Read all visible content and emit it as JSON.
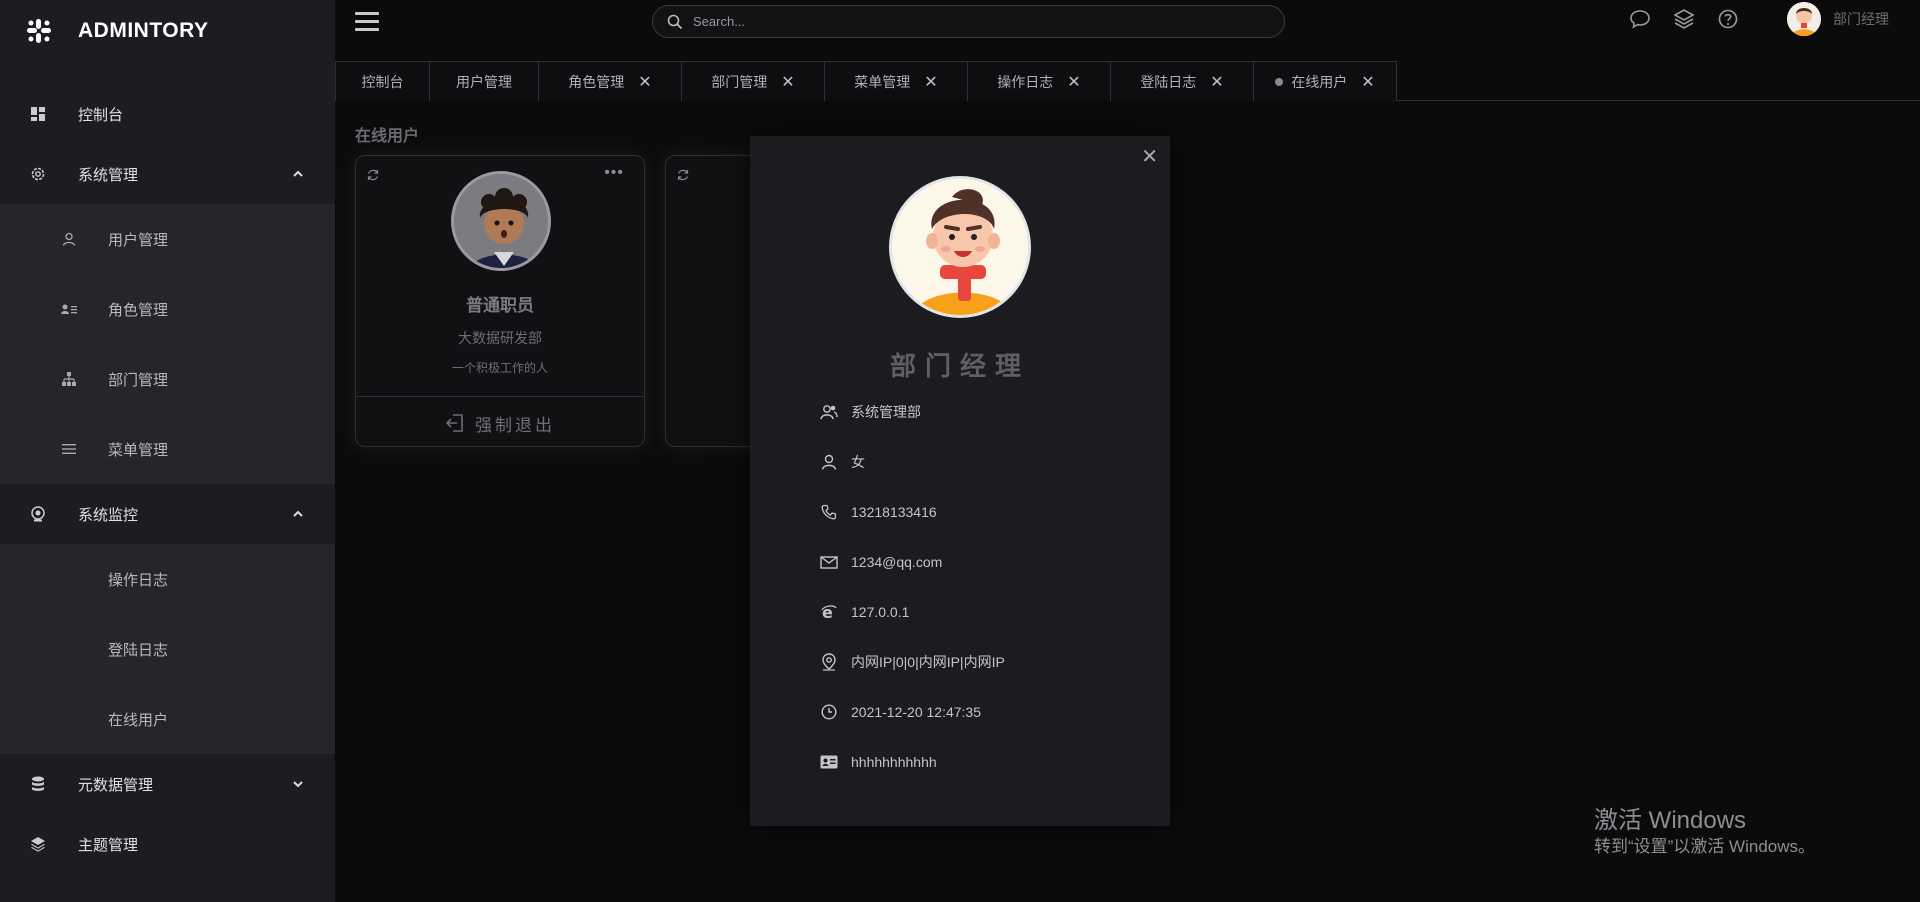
{
  "brand": {
    "name": "ADMINTORY"
  },
  "sidebar": {
    "items": [
      {
        "label": "控制台"
      },
      {
        "label": "系统管理"
      },
      {
        "label": "系统监控"
      },
      {
        "label": "元数据管理"
      },
      {
        "label": "主题管理"
      }
    ],
    "system_sub": [
      {
        "label": "用户管理"
      },
      {
        "label": "角色管理"
      },
      {
        "label": "部门管理"
      },
      {
        "label": "菜单管理"
      }
    ],
    "monitor_sub": [
      {
        "label": "操作日志"
      },
      {
        "label": "登陆日志"
      },
      {
        "label": "在线用户"
      }
    ]
  },
  "header": {
    "search_placeholder": "Search...",
    "user_name": "部门经理"
  },
  "tabs": [
    {
      "label": "控制台",
      "closable": false
    },
    {
      "label": "用户管理",
      "closable": false
    },
    {
      "label": "角色管理",
      "closable": true
    },
    {
      "label": "部门管理",
      "closable": true
    },
    {
      "label": "菜单管理",
      "closable": true
    },
    {
      "label": "操作日志",
      "closable": true
    },
    {
      "label": "登陆日志",
      "closable": true
    },
    {
      "label": "在线用户",
      "closable": true,
      "active": true
    }
  ],
  "tab_close_glyph": "✕",
  "page": {
    "title": "在线用户"
  },
  "card": {
    "name": "普通职员",
    "dept": "大数据研发部",
    "motto": "一个积极工作的人",
    "logout_label": "强制退出",
    "more_glyph": "•••"
  },
  "modal": {
    "close_glyph": "✕",
    "role": "部门经理",
    "dept": "系统管理部",
    "gender": "女",
    "phone": "13218133416",
    "email": "1234@qq.com",
    "ip": "127.0.0.1",
    "location": "内网IP|0|0|内网IP|内网IP",
    "login_time": "2021-12-20 12:47:35",
    "note": "hhhhhhhhhhh"
  },
  "watermark": {
    "line1": "激活 Windows",
    "line2": "转到“设置”以激活 Windows。"
  },
  "colors": {
    "sidebar_bg": "#1d1d21",
    "submenu_bg": "#25252a",
    "page_bg": "#0b0b0c",
    "modal_bg": "#1c1c20"
  }
}
